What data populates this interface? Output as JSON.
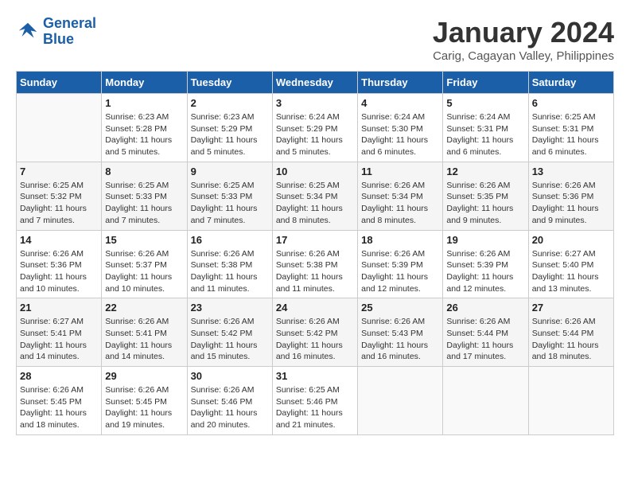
{
  "header": {
    "logo_line1": "General",
    "logo_line2": "Blue",
    "month": "January 2024",
    "location": "Carig, Cagayan Valley, Philippines"
  },
  "days_of_week": [
    "Sunday",
    "Monday",
    "Tuesday",
    "Wednesday",
    "Thursday",
    "Friday",
    "Saturday"
  ],
  "weeks": [
    [
      {
        "day": "",
        "sunrise": "",
        "sunset": "",
        "daylight": ""
      },
      {
        "day": "1",
        "sunrise": "6:23 AM",
        "sunset": "5:28 PM",
        "daylight": "11 hours and 5 minutes."
      },
      {
        "day": "2",
        "sunrise": "6:23 AM",
        "sunset": "5:29 PM",
        "daylight": "11 hours and 5 minutes."
      },
      {
        "day": "3",
        "sunrise": "6:24 AM",
        "sunset": "5:29 PM",
        "daylight": "11 hours and 5 minutes."
      },
      {
        "day": "4",
        "sunrise": "6:24 AM",
        "sunset": "5:30 PM",
        "daylight": "11 hours and 6 minutes."
      },
      {
        "day": "5",
        "sunrise": "6:24 AM",
        "sunset": "5:31 PM",
        "daylight": "11 hours and 6 minutes."
      },
      {
        "day": "6",
        "sunrise": "6:25 AM",
        "sunset": "5:31 PM",
        "daylight": "11 hours and 6 minutes."
      }
    ],
    [
      {
        "day": "7",
        "sunrise": "6:25 AM",
        "sunset": "5:32 PM",
        "daylight": "11 hours and 7 minutes."
      },
      {
        "day": "8",
        "sunrise": "6:25 AM",
        "sunset": "5:33 PM",
        "daylight": "11 hours and 7 minutes."
      },
      {
        "day": "9",
        "sunrise": "6:25 AM",
        "sunset": "5:33 PM",
        "daylight": "11 hours and 7 minutes."
      },
      {
        "day": "10",
        "sunrise": "6:25 AM",
        "sunset": "5:34 PM",
        "daylight": "11 hours and 8 minutes."
      },
      {
        "day": "11",
        "sunrise": "6:26 AM",
        "sunset": "5:34 PM",
        "daylight": "11 hours and 8 minutes."
      },
      {
        "day": "12",
        "sunrise": "6:26 AM",
        "sunset": "5:35 PM",
        "daylight": "11 hours and 9 minutes."
      },
      {
        "day": "13",
        "sunrise": "6:26 AM",
        "sunset": "5:36 PM",
        "daylight": "11 hours and 9 minutes."
      }
    ],
    [
      {
        "day": "14",
        "sunrise": "6:26 AM",
        "sunset": "5:36 PM",
        "daylight": "11 hours and 10 minutes."
      },
      {
        "day": "15",
        "sunrise": "6:26 AM",
        "sunset": "5:37 PM",
        "daylight": "11 hours and 10 minutes."
      },
      {
        "day": "16",
        "sunrise": "6:26 AM",
        "sunset": "5:38 PM",
        "daylight": "11 hours and 11 minutes."
      },
      {
        "day": "17",
        "sunrise": "6:26 AM",
        "sunset": "5:38 PM",
        "daylight": "11 hours and 11 minutes."
      },
      {
        "day": "18",
        "sunrise": "6:26 AM",
        "sunset": "5:39 PM",
        "daylight": "11 hours and 12 minutes."
      },
      {
        "day": "19",
        "sunrise": "6:26 AM",
        "sunset": "5:39 PM",
        "daylight": "11 hours and 12 minutes."
      },
      {
        "day": "20",
        "sunrise": "6:27 AM",
        "sunset": "5:40 PM",
        "daylight": "11 hours and 13 minutes."
      }
    ],
    [
      {
        "day": "21",
        "sunrise": "6:27 AM",
        "sunset": "5:41 PM",
        "daylight": "11 hours and 14 minutes."
      },
      {
        "day": "22",
        "sunrise": "6:26 AM",
        "sunset": "5:41 PM",
        "daylight": "11 hours and 14 minutes."
      },
      {
        "day": "23",
        "sunrise": "6:26 AM",
        "sunset": "5:42 PM",
        "daylight": "11 hours and 15 minutes."
      },
      {
        "day": "24",
        "sunrise": "6:26 AM",
        "sunset": "5:42 PM",
        "daylight": "11 hours and 16 minutes."
      },
      {
        "day": "25",
        "sunrise": "6:26 AM",
        "sunset": "5:43 PM",
        "daylight": "11 hours and 16 minutes."
      },
      {
        "day": "26",
        "sunrise": "6:26 AM",
        "sunset": "5:44 PM",
        "daylight": "11 hours and 17 minutes."
      },
      {
        "day": "27",
        "sunrise": "6:26 AM",
        "sunset": "5:44 PM",
        "daylight": "11 hours and 18 minutes."
      }
    ],
    [
      {
        "day": "28",
        "sunrise": "6:26 AM",
        "sunset": "5:45 PM",
        "daylight": "11 hours and 18 minutes."
      },
      {
        "day": "29",
        "sunrise": "6:26 AM",
        "sunset": "5:45 PM",
        "daylight": "11 hours and 19 minutes."
      },
      {
        "day": "30",
        "sunrise": "6:26 AM",
        "sunset": "5:46 PM",
        "daylight": "11 hours and 20 minutes."
      },
      {
        "day": "31",
        "sunrise": "6:25 AM",
        "sunset": "5:46 PM",
        "daylight": "11 hours and 21 minutes."
      },
      {
        "day": "",
        "sunrise": "",
        "sunset": "",
        "daylight": ""
      },
      {
        "day": "",
        "sunrise": "",
        "sunset": "",
        "daylight": ""
      },
      {
        "day": "",
        "sunrise": "",
        "sunset": "",
        "daylight": ""
      }
    ]
  ]
}
